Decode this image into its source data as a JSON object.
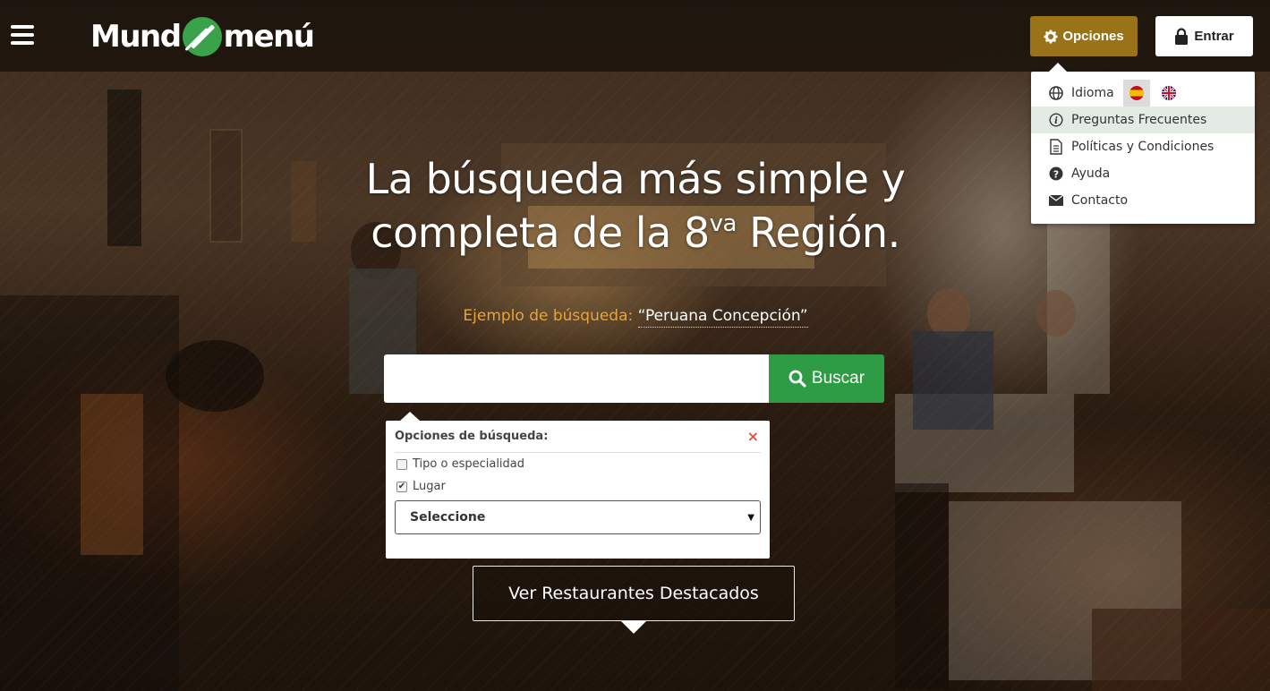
{
  "header": {
    "logo_left": "Mund",
    "logo_right": "menú",
    "options_label": "Opciones",
    "login_label": "Entrar"
  },
  "options_menu": {
    "language_label": "Idioma",
    "languages": [
      "es",
      "en"
    ],
    "selected_language": "es",
    "items": [
      {
        "label": "Preguntas Frecuentes",
        "icon": "info-icon"
      },
      {
        "label": "Políticas y Condiciones",
        "icon": "document-icon"
      },
      {
        "label": "Ayuda",
        "icon": "help-icon"
      },
      {
        "label": "Contacto",
        "icon": "envelope-icon"
      }
    ]
  },
  "hero": {
    "headline_line1": "La búsqueda más simple y",
    "headline_line2_pre": "completa de la 8",
    "headline_sup": "va",
    "headline_line2_post": " Región.",
    "example_label": "Ejemplo de búsqueda:",
    "example_value": "“Peruana Concepción”"
  },
  "search": {
    "input_value": "",
    "button_label": "Buscar"
  },
  "search_options": {
    "title": "Opciones de búsqueda:",
    "close_glyph": "×",
    "checkboxes": [
      {
        "label": "Tipo o especialidad",
        "checked": false
      },
      {
        "label": "Lugar",
        "checked": true
      }
    ],
    "select_value": "Seleccione"
  },
  "featured_button": "Ver Restaurantes Destacados",
  "colors": {
    "accent_gold": "#9a7318",
    "search_green": "#2e9b45",
    "example_orange": "#e8a43a",
    "close_red": "#d9534f"
  }
}
